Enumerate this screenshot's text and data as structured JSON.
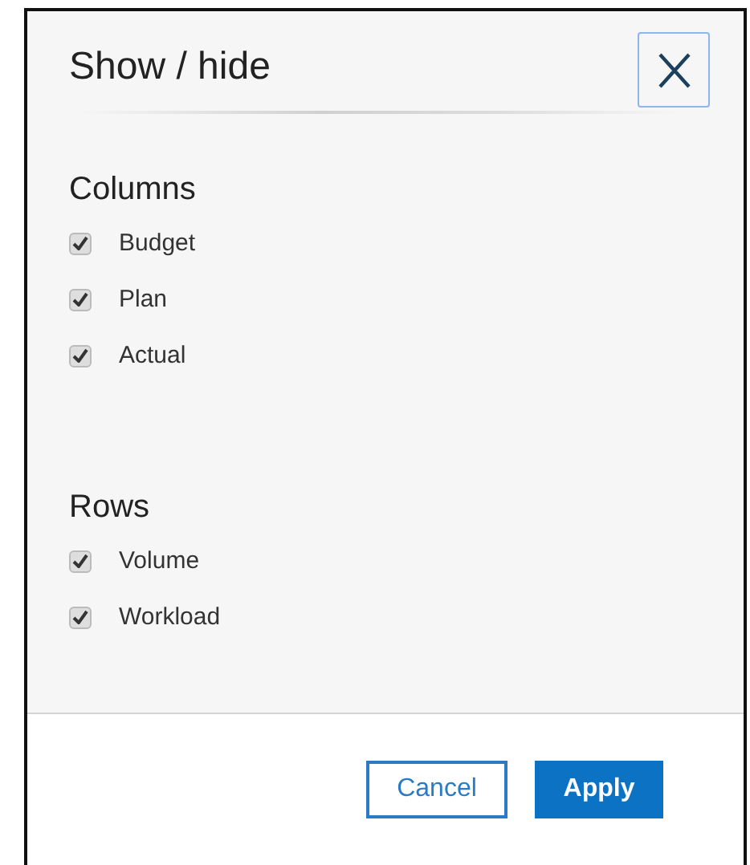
{
  "dialog": {
    "title": "Show / hide"
  },
  "sections": [
    {
      "heading": "Columns",
      "items": [
        {
          "label": "Budget",
          "checked": true
        },
        {
          "label": "Plan",
          "checked": true
        },
        {
          "label": "Actual",
          "checked": true
        }
      ]
    },
    {
      "heading": "Rows",
      "items": [
        {
          "label": "Volume",
          "checked": true
        },
        {
          "label": "Workload",
          "checked": true
        }
      ]
    }
  ],
  "buttons": [
    {
      "label": "Cancel",
      "kind": "secondary"
    },
    {
      "label": "Apply",
      "kind": "primary"
    }
  ]
}
